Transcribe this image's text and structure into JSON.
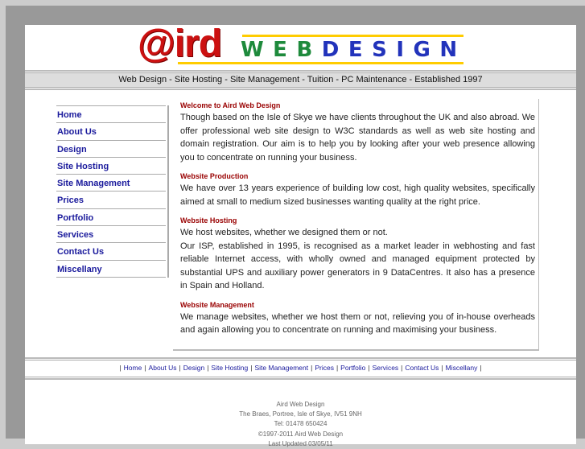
{
  "colors": {
    "outer_bg": "#cccccc",
    "frame": "#999999",
    "nav_link": "#1a1a9c",
    "heading_red": "#990000",
    "logo_red": "#cc1111",
    "logo_green": "#1e8a3c",
    "logo_blue": "#2233bb",
    "logo_yellow": "#ffcc00"
  },
  "logo": {
    "at_text": "@ird",
    "green_part": "WEB",
    "blue_part": "DESIGN"
  },
  "tagline": "Web Design - Site Hosting - Site Management - Tuition - PC Maintenance - Established 1997",
  "sidebar": {
    "items": [
      {
        "label": "Home"
      },
      {
        "label": "About Us"
      },
      {
        "label": "Design"
      },
      {
        "label": "Site Hosting"
      },
      {
        "label": "Site Management"
      },
      {
        "label": "Prices"
      },
      {
        "label": "Portfolio"
      },
      {
        "label": "Services"
      },
      {
        "label": "Contact Us"
      },
      {
        "label": "Miscellany"
      }
    ]
  },
  "content": {
    "sections": [
      {
        "heading": "Welcome to Aird Web Design",
        "paragraphs": [
          "Though based on the Isle of Skye we have clients throughout the UK and also abroad. We offer professional web site design to W3C standards as well as web site hosting and domain registration. Our aim is to help you by looking after your web presence allowing you to concentrate on running your business."
        ]
      },
      {
        "heading": "Website Production",
        "paragraphs": [
          "We have over 13 years experience of building low cost, high quality websites, specifically aimed at small to medium sized businesses wanting quality at the right price."
        ]
      },
      {
        "heading": "Website Hosting",
        "paragraphs": [
          "We host websites, whether we designed them or not.",
          "Our ISP, established in 1995, is recognised as a market leader in webhosting and fast reliable Internet access, with wholly owned and managed equipment protected by substantial UPS and auxiliary power generators in 9 DataCentres. It also has a presence in Spain and Holland."
        ]
      },
      {
        "heading": "Website Management",
        "paragraphs": [
          "We manage websites, whether we host them or not, relieving you of in-house overheads and again allowing you to concentrate on running and maximising your business."
        ]
      }
    ]
  },
  "footer_nav": {
    "separator": "|",
    "items": [
      {
        "label": "Home"
      },
      {
        "label": "About Us"
      },
      {
        "label": "Design"
      },
      {
        "label": "Site Hosting"
      },
      {
        "label": "Site Management"
      },
      {
        "label": "Prices"
      },
      {
        "label": "Portfolio"
      },
      {
        "label": "Services"
      },
      {
        "label": "Contact Us"
      },
      {
        "label": "Miscellany"
      }
    ]
  },
  "address": {
    "lines": [
      "Aird Web Design",
      "The Braes, Portree, Isle of Skye, IV51 9NH",
      "Tel: 01478 650424",
      "©1997-2011 Aird Web Design",
      "Last Updated 03/05/11"
    ]
  }
}
